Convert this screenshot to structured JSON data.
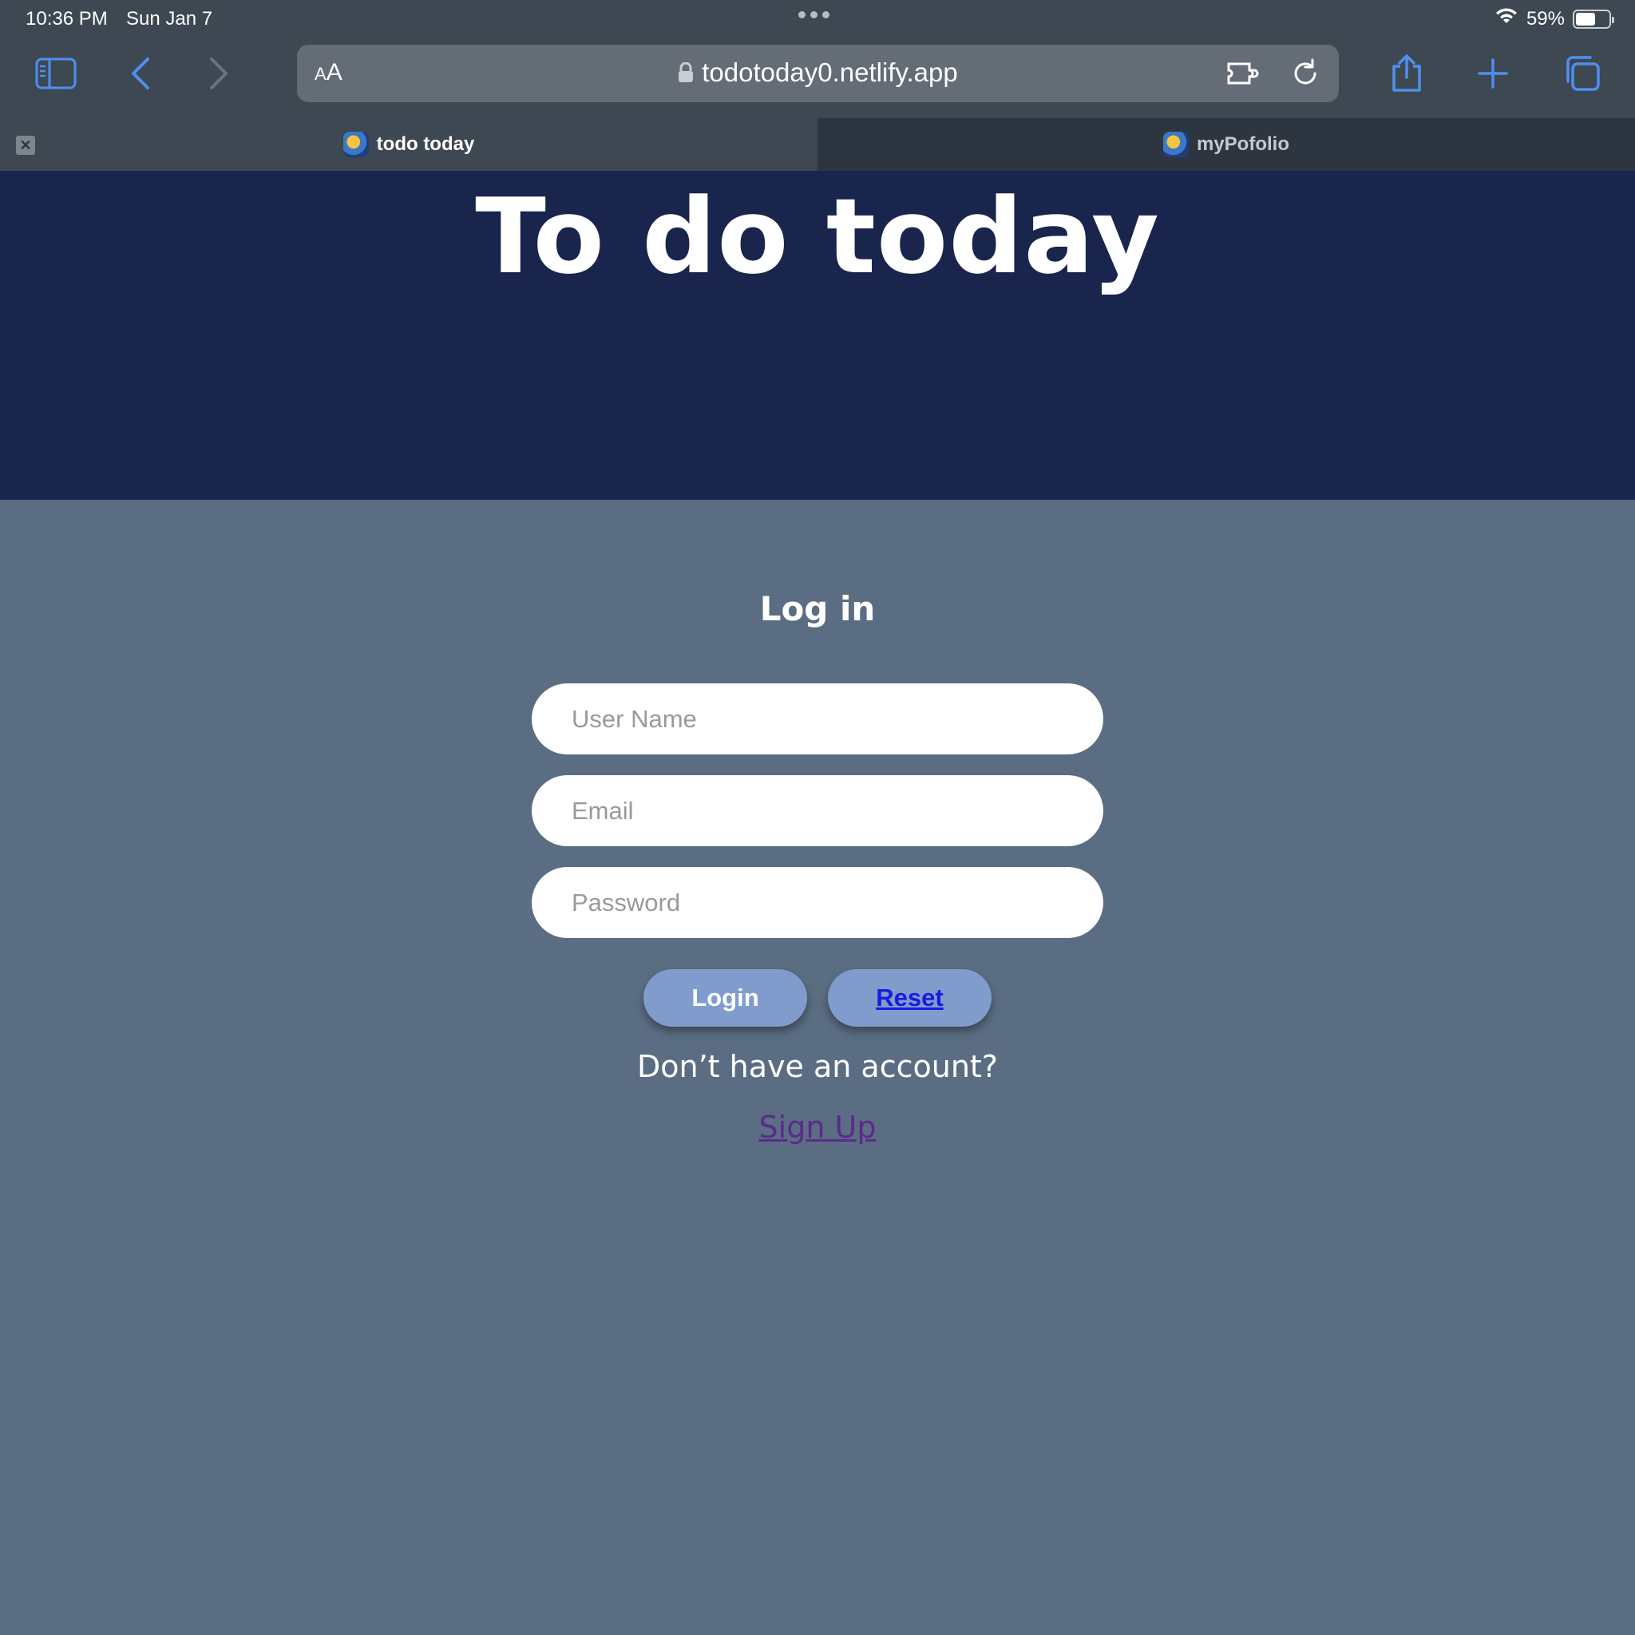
{
  "status_bar": {
    "time": "10:36 PM",
    "date": "Sun Jan 7",
    "battery_percent": "59%",
    "battery_level": 0.59
  },
  "browser": {
    "text_size_small": "A",
    "text_size_big": "A",
    "url": "todotoday0.netlify.app",
    "tabs": [
      {
        "label": "todo today",
        "active": true
      },
      {
        "label": "myPofolio",
        "active": false
      }
    ],
    "icons": {
      "sidebar": "sidebar-icon",
      "back": "chevron-left-icon",
      "forward": "chevron-right-icon",
      "extension": "extension-icon",
      "reload": "reload-icon",
      "share": "share-icon",
      "new_tab": "plus-icon",
      "tabs_overview": "tabs-icon"
    },
    "accent_color": "#4f8ff0"
  },
  "page": {
    "title": "To do today",
    "login_heading": "Log in",
    "fields": {
      "username_placeholder": "User Name",
      "email_placeholder": "Email",
      "password_placeholder": "Password"
    },
    "buttons": {
      "login": "Login",
      "reset": "Reset"
    },
    "no_account_text": "Don’t have an account?",
    "signup_link": "Sign Up",
    "colors": {
      "header_bg": "#1a254d",
      "body_bg": "#5a6d82",
      "button_bg": "#7f9ccc"
    }
  }
}
